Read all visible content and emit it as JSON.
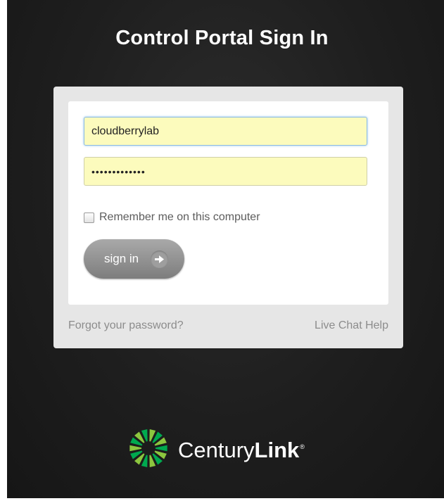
{
  "header": {
    "title": "Control Portal Sign In"
  },
  "form": {
    "username_value": "cloudberrylab",
    "password_value": "•••••••••••••",
    "remember_label": "Remember me on this computer",
    "remember_checked": false,
    "signin_label": "sign in"
  },
  "links": {
    "forgot_password": "Forgot your password?",
    "live_chat": "Live Chat Help"
  },
  "brand": {
    "name_regular": "Century",
    "name_bold": "Link",
    "registered_mark": "®",
    "logo_colors": [
      "#00a94f",
      "#8cc63f"
    ]
  },
  "icons": {
    "signin_arrow": "arrow-right-icon",
    "logo": "centurylink-logo-icon"
  }
}
